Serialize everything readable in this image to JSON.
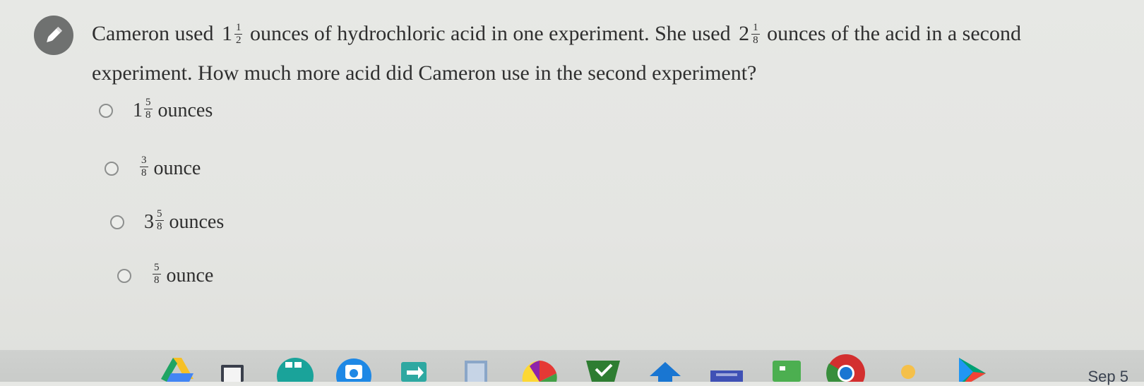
{
  "question": {
    "intro": "Cameron used",
    "a_whole": "1",
    "a_num": "1",
    "a_den": "2",
    "middle": "ounces of hydrochloric acid in one experiment. She used",
    "b_whole": "2",
    "b_num": "1",
    "b_den": "8",
    "end": "ounces of the acid in a second experiment. How much more acid did Cameron use in the second experiment?"
  },
  "options": [
    {
      "whole": "1",
      "num": "5",
      "den": "8",
      "unit": "ounces"
    },
    {
      "whole": "",
      "num": "3",
      "den": "8",
      "unit": "ounce"
    },
    {
      "whole": "3",
      "num": "5",
      "den": "8",
      "unit": "ounces"
    },
    {
      "whole": "",
      "num": "5",
      "den": "8",
      "unit": "ounce"
    }
  ],
  "taskbar": {
    "date": "Sep 5",
    "icons": [
      "drive-icon",
      "laptop-icon",
      "sheets-icon",
      "camera-icon",
      "forms-icon",
      "docs-icon",
      "pie-chart-icon",
      "classroom-icon",
      "arrow-icon",
      "screencast-icon",
      "calculator-icon",
      "chrome-icon",
      "keep-icon",
      "play-store-icon"
    ]
  },
  "colors": {
    "badge": "#6f7170",
    "taskbar": "#cdcfcd",
    "text": "#2f2f2f"
  }
}
